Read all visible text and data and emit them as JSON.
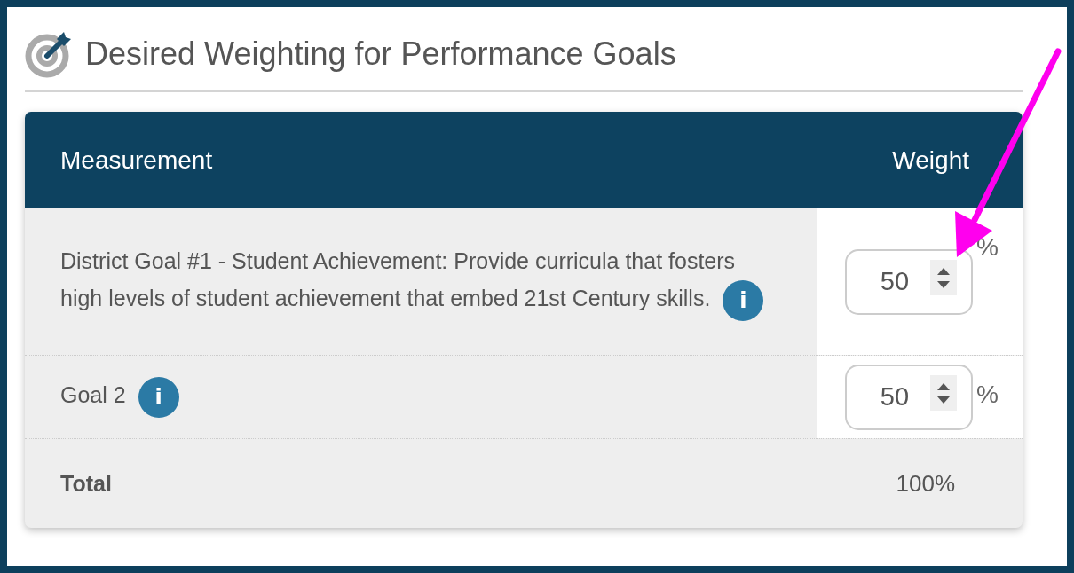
{
  "title": "Desired Weighting for Performance Goals",
  "table": {
    "columns": [
      "Measurement",
      "Weight"
    ],
    "rows": [
      {
        "measurement": "District Goal #1 - Student Achievement: Provide curricula that fosters high levels of student achievement that embed 21st Century skills.",
        "info": "i",
        "weight": "50",
        "unit": "%"
      },
      {
        "measurement": "Goal 2",
        "info": "i",
        "weight": "50",
        "unit": "%"
      }
    ],
    "total": {
      "label": "Total",
      "value": "100%"
    }
  }
}
